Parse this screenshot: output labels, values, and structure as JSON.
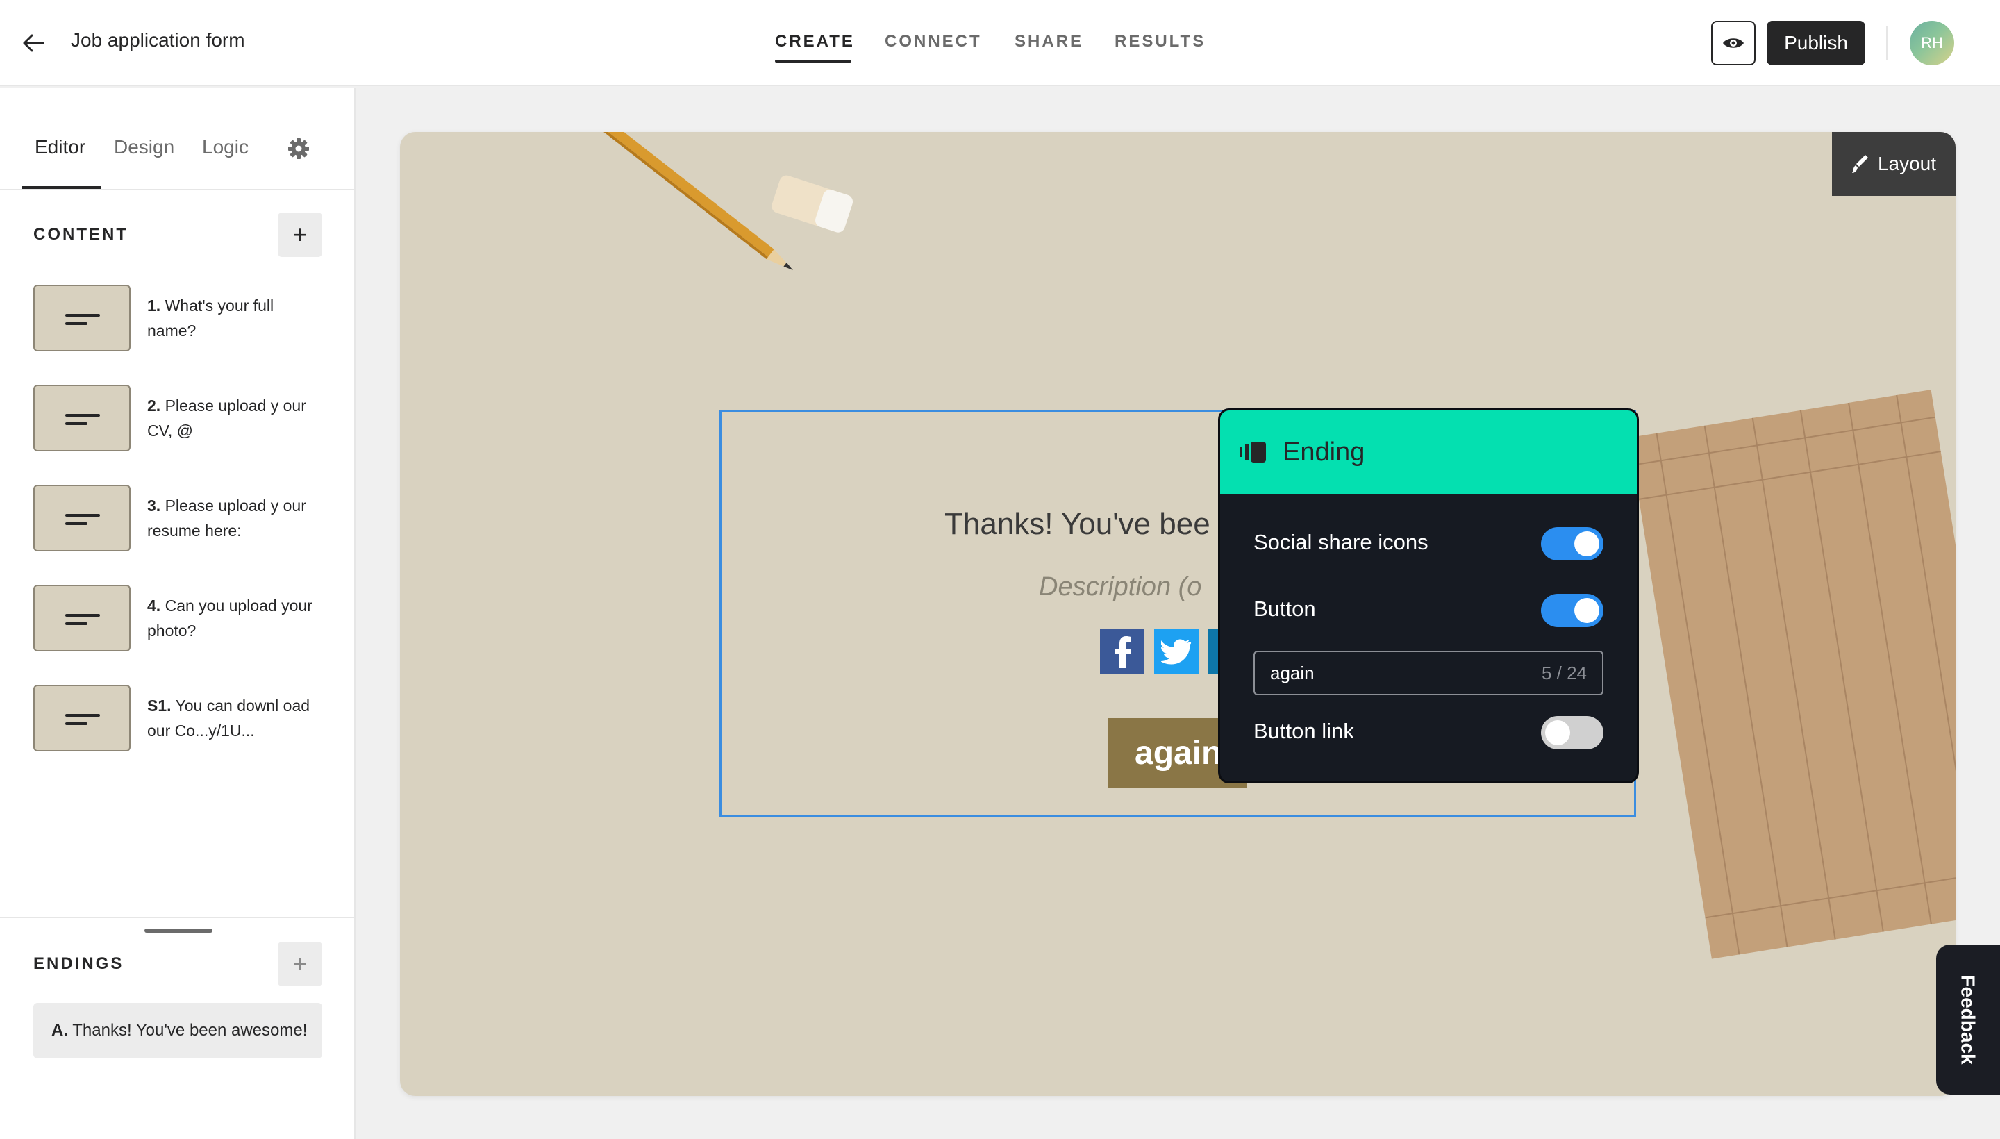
{
  "header": {
    "form_title": "Job application form",
    "tabs": [
      {
        "label": "CREATE",
        "active": true
      },
      {
        "label": "CONNECT",
        "active": false
      },
      {
        "label": "SHARE",
        "active": false
      },
      {
        "label": "RESULTS",
        "active": false
      }
    ],
    "publish_label": "Publish",
    "avatar_initials": "RH"
  },
  "sidebar": {
    "tabs": [
      {
        "label": "Editor",
        "active": true
      },
      {
        "label": "Design",
        "active": false
      },
      {
        "label": "Logic",
        "active": false
      }
    ],
    "content_label": "CONTENT",
    "questions": [
      {
        "num": "1.",
        "text": "What's your full name?"
      },
      {
        "num": "2.",
        "text": "Please upload y our CV, @"
      },
      {
        "num": "3.",
        "text": "Please upload y our resume here:"
      },
      {
        "num": "4.",
        "text": "Can you upload your photo?"
      },
      {
        "num": "S1.",
        "text": "You can downl oad our Co...y/1U..."
      }
    ],
    "endings_label": "ENDINGS",
    "endings": [
      {
        "num": "A.",
        "text": "Thanks! You've been awesome!"
      }
    ]
  },
  "canvas": {
    "layout_label": "Layout",
    "ending_title": "Thanks! You've bee",
    "ending_description": "Description (o",
    "button_label": "again"
  },
  "ending_panel": {
    "title": "Ending",
    "social_share_label": "Social share icons",
    "social_share_on": true,
    "button_label": "Button",
    "button_on": true,
    "button_text_value": "again",
    "button_text_count": "5 / 24",
    "button_link_label": "Button link",
    "button_link_on": false
  },
  "feedback_label": "Feedback",
  "colors": {
    "accent_teal": "#04e0b0",
    "toggle_blue": "#2b8ef0",
    "canvas_bg": "#d9d2c0",
    "button_brown": "#8a7646"
  }
}
